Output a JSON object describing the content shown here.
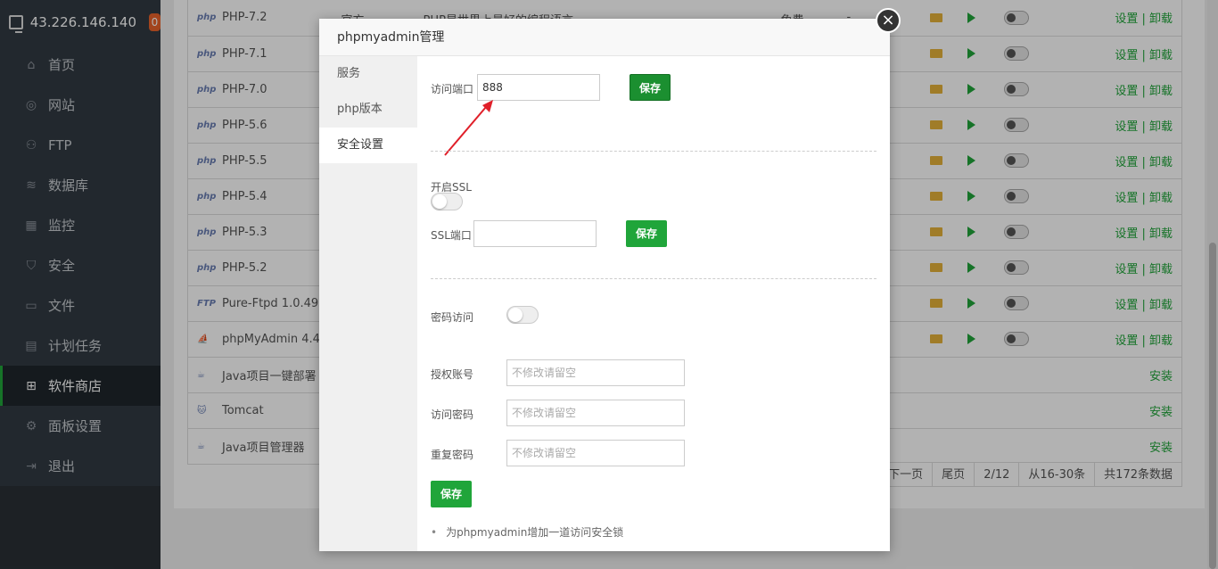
{
  "sidebar": {
    "ip": "43.226.146.140",
    "badge": "0",
    "items": [
      {
        "label": "首页",
        "icon": "home-icon",
        "glyph": "⌂"
      },
      {
        "label": "网站",
        "icon": "globe-icon",
        "glyph": "◎"
      },
      {
        "label": "FTP",
        "icon": "ftp-icon",
        "glyph": "⚇"
      },
      {
        "label": "数据库",
        "icon": "database-icon",
        "glyph": "≋"
      },
      {
        "label": "监控",
        "icon": "monitor-icon",
        "glyph": "▦"
      },
      {
        "label": "安全",
        "icon": "shield-icon",
        "glyph": "⛉"
      },
      {
        "label": "文件",
        "icon": "folder-icon",
        "glyph": "▭"
      },
      {
        "label": "计划任务",
        "icon": "calendar-icon",
        "glyph": "▤"
      },
      {
        "label": "软件商店",
        "icon": "grid-icon",
        "glyph": "⊞"
      },
      {
        "label": "面板设置",
        "icon": "gear-icon",
        "glyph": "⚙"
      },
      {
        "label": "退出",
        "icon": "logout-icon",
        "glyph": "⇥"
      }
    ],
    "active_index": 8
  },
  "table": {
    "first_row": {
      "name": "PHP-7.2",
      "dev": "官方",
      "desc": "PHP是世界上最好的编程语言",
      "price": "免费",
      "expire": "--"
    },
    "rows": [
      {
        "name": "PHP-7.2",
        "logo": "php",
        "action": "设置 | 卸载"
      },
      {
        "name": "PHP-7.1",
        "logo": "php",
        "action": "设置 | 卸载"
      },
      {
        "name": "PHP-7.0",
        "logo": "php",
        "action": "设置 | 卸载"
      },
      {
        "name": "PHP-5.6",
        "logo": "php",
        "action": "设置 | 卸载"
      },
      {
        "name": "PHP-5.5",
        "logo": "php",
        "action": "设置 | 卸载"
      },
      {
        "name": "PHP-5.4",
        "logo": "php",
        "action": "设置 | 卸载"
      },
      {
        "name": "PHP-5.3",
        "logo": "php",
        "action": "设置 | 卸载"
      },
      {
        "name": "PHP-5.2",
        "logo": "php",
        "action": "设置 | 卸载"
      },
      {
        "name": "Pure-Ftpd 1.0.49",
        "logo": "FTP",
        "action": "设置 | 卸载"
      },
      {
        "name": "phpMyAdmin 4.4",
        "logo": "⛵",
        "action": "设置 | 卸载"
      },
      {
        "name": "Java项目一键部署",
        "logo": "☕",
        "action": "安装"
      },
      {
        "name": "Tomcat",
        "logo": "🐱",
        "action": "安装"
      },
      {
        "name": "Java项目管理器",
        "logo": "☕",
        "action": "安装"
      }
    ],
    "pager": [
      "下一页",
      "尾页",
      "2/12",
      "从16-30条",
      "共172条数据"
    ]
  },
  "modal": {
    "title": "phpmyadmin管理",
    "close": "×",
    "tabs": [
      "服务",
      "php版本",
      "安全设置"
    ],
    "active_tab": 2,
    "port_label": "访问端口",
    "port_value": "888",
    "save_label": "保存",
    "ssl_label": "开启SSL",
    "ssl_port_label": "SSL端口",
    "ssl_port_value": "",
    "password_access_label": "密码访问",
    "auth_user_label": "授权账号",
    "auth_user_placeholder": "不修改请留空",
    "access_password_label": "访问密码",
    "access_password_placeholder": "不修改请留空",
    "repeat_password_label": "重复密码",
    "repeat_password_placeholder": "不修改请留空",
    "tip": "为phpmyadmin增加一道访问安全锁"
  },
  "colors": {
    "accent": "#20a53a",
    "sidebar": "#313a42",
    "badge": "#e8622a",
    "arrow": "#e0202a"
  }
}
